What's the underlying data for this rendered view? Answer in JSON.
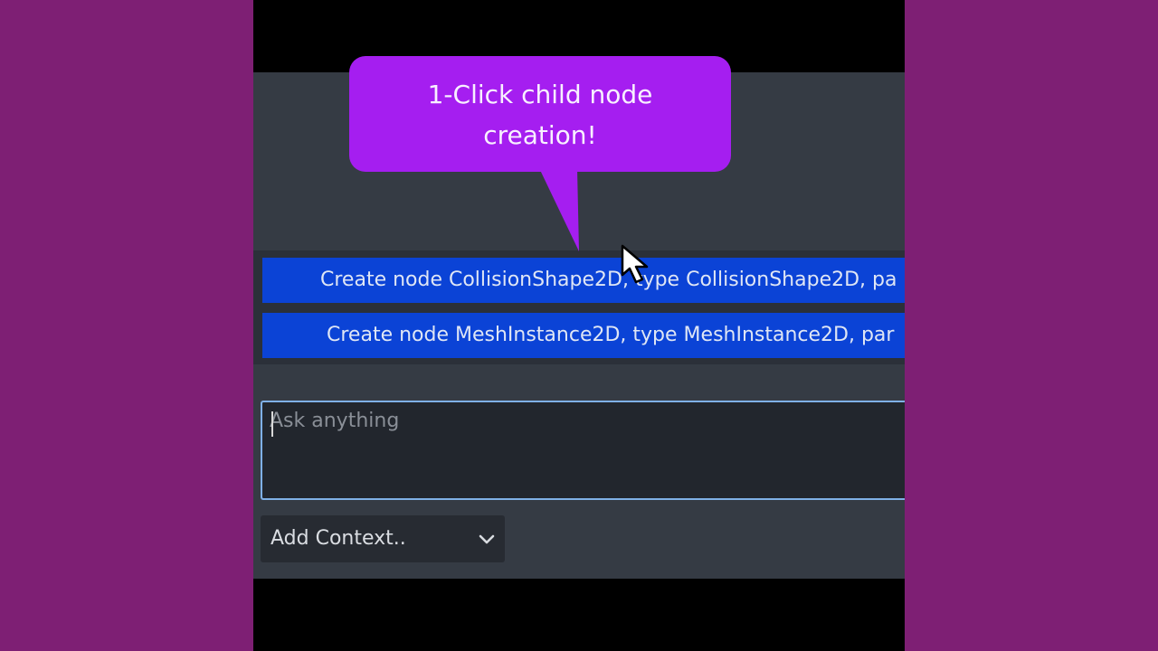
{
  "callout": {
    "line1": "1-Click child node",
    "line2": "creation!"
  },
  "suggestions": [
    {
      "label": "Create node CollisionShape2D, type CollisionShape2D, pa"
    },
    {
      "label": "Create node MeshInstance2D, type MeshInstance2D, par"
    }
  ],
  "prompt": {
    "placeholder": "Ask anything",
    "value": ""
  },
  "context_select": {
    "label": "Add Context.."
  },
  "icons": {
    "chevron": "chevron-down-icon",
    "cursor": "mouse-cursor-icon"
  },
  "colors": {
    "background": "#7e1f74",
    "callout": "#a51ef0",
    "suggestion": "#0b43d6",
    "prompt_border": "#7fb0e6"
  }
}
